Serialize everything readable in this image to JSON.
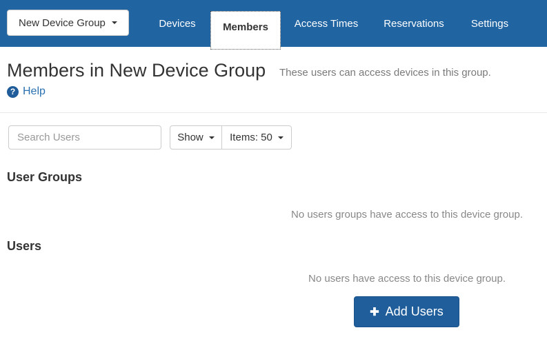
{
  "header": {
    "group_button": {
      "label": "New Device Group"
    },
    "tabs": [
      {
        "label": "Devices",
        "active": false
      },
      {
        "label": "Members",
        "active": true
      },
      {
        "label": "Access Times",
        "active": false
      },
      {
        "label": "Reservations",
        "active": false
      },
      {
        "label": "Settings",
        "active": false
      }
    ]
  },
  "page": {
    "title": "Members in New Device Group",
    "subtitle": "These users can access devices in this group.",
    "help": {
      "icon": "?",
      "label": "Help"
    }
  },
  "toolbar": {
    "search_placeholder": "Search Users",
    "show_button": "Show",
    "items_button": "Items: 50"
  },
  "sections": {
    "user_groups": {
      "heading": "User Groups",
      "empty_text": "No users groups have access to this device group."
    },
    "users": {
      "heading": "Users",
      "empty_text": "No users have access to this device group.",
      "add_button": {
        "icon": "✚",
        "label": "Add Users"
      }
    }
  },
  "colors": {
    "header_bg": "#2064a2",
    "add_button_bg": "#1f5e9b",
    "link": "#2970b0",
    "empty_text": "#888888"
  }
}
